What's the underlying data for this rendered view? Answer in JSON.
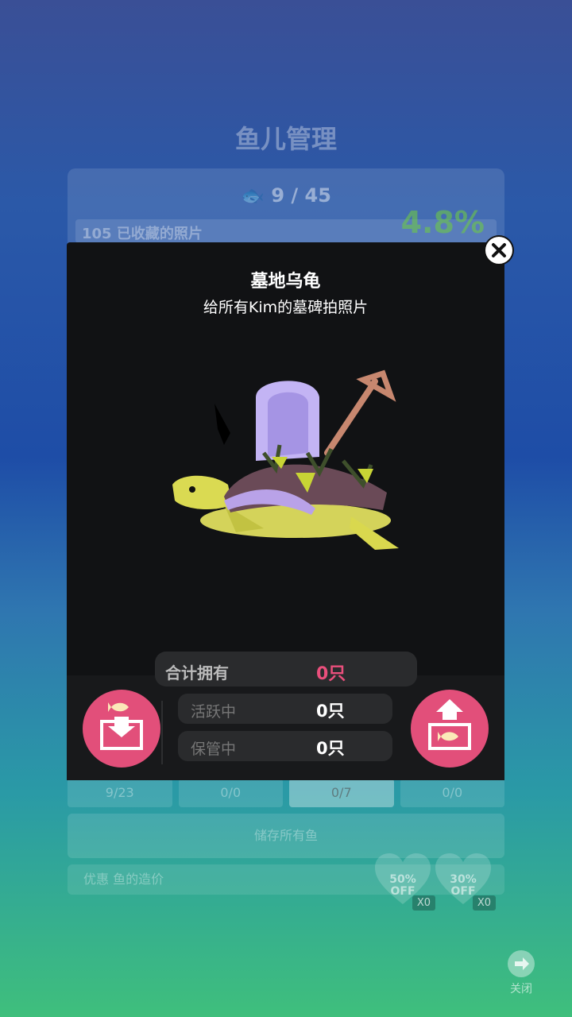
{
  "background": {
    "title": "鱼儿管理",
    "fish_count": "9 / 45",
    "progress_text": "105 已收藏的照片",
    "percent": "4.8%",
    "tabs": [
      "9/23",
      "0/0",
      "0/7",
      "0/0"
    ],
    "store_all_label": "储存所有鱼",
    "discount_label": "优惠 鱼的造价",
    "coupons": [
      {
        "label": "50%\nOFF",
        "count": "X0"
      },
      {
        "label": "30%\nOFF",
        "count": "X0"
      }
    ],
    "close_label": "关闭"
  },
  "modal": {
    "title": "墓地乌龟",
    "subtitle": "给所有Kim的墓碑拍照片",
    "total_label": "合计拥有",
    "total_value": "0只",
    "active_label": "活跃中",
    "active_value": "0只",
    "stored_label": "保管中",
    "stored_value": "0只"
  },
  "colors": {
    "accent_pink": "#e24f7a",
    "total_value": "#ea4f7c",
    "modal_bg": "#111214"
  }
}
